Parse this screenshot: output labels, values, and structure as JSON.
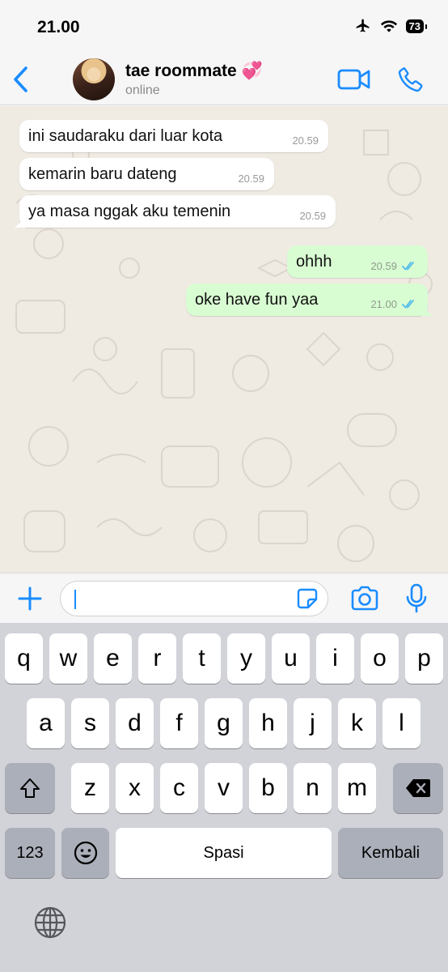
{
  "status_bar": {
    "time": "21.00",
    "battery": "73"
  },
  "header": {
    "contact_name": "tae roommate 💞",
    "contact_status": "online"
  },
  "messages": [
    {
      "direction": "in",
      "text": "ini saudaraku dari luar kota",
      "time": "20.59"
    },
    {
      "direction": "in",
      "text": "kemarin baru dateng",
      "time": "20.59"
    },
    {
      "direction": "in",
      "text": "ya masa nggak aku temenin",
      "time": "20.59"
    },
    {
      "direction": "out",
      "text": "ohhh",
      "time": "20.59",
      "status": "read"
    },
    {
      "direction": "out",
      "text": "oke have fun yaa",
      "time": "21.00",
      "status": "read"
    }
  ],
  "input": {
    "value": "",
    "placeholder": ""
  },
  "keyboard": {
    "row1": [
      "q",
      "w",
      "e",
      "r",
      "t",
      "y",
      "u",
      "i",
      "o",
      "p"
    ],
    "row2": [
      "a",
      "s",
      "d",
      "f",
      "g",
      "h",
      "j",
      "k",
      "l"
    ],
    "row3": [
      "z",
      "x",
      "c",
      "v",
      "b",
      "n",
      "m"
    ],
    "numbers_key": "123",
    "space_key": "Spasi",
    "return_key": "Kembali"
  },
  "colors": {
    "accent": "#1a8cff",
    "incoming_bubble": "#ffffff",
    "outgoing_bubble": "#d9fdd3",
    "chat_background": "#efeae2",
    "read_ticks": "#53bdeb"
  },
  "icons": [
    "back-chevron-icon",
    "video-call-icon",
    "phone-icon",
    "plus-icon",
    "sticker-icon",
    "camera-icon",
    "microphone-icon",
    "shift-icon",
    "backspace-icon",
    "emoji-icon",
    "globe-icon",
    "airplane-icon",
    "wifi-icon"
  ]
}
